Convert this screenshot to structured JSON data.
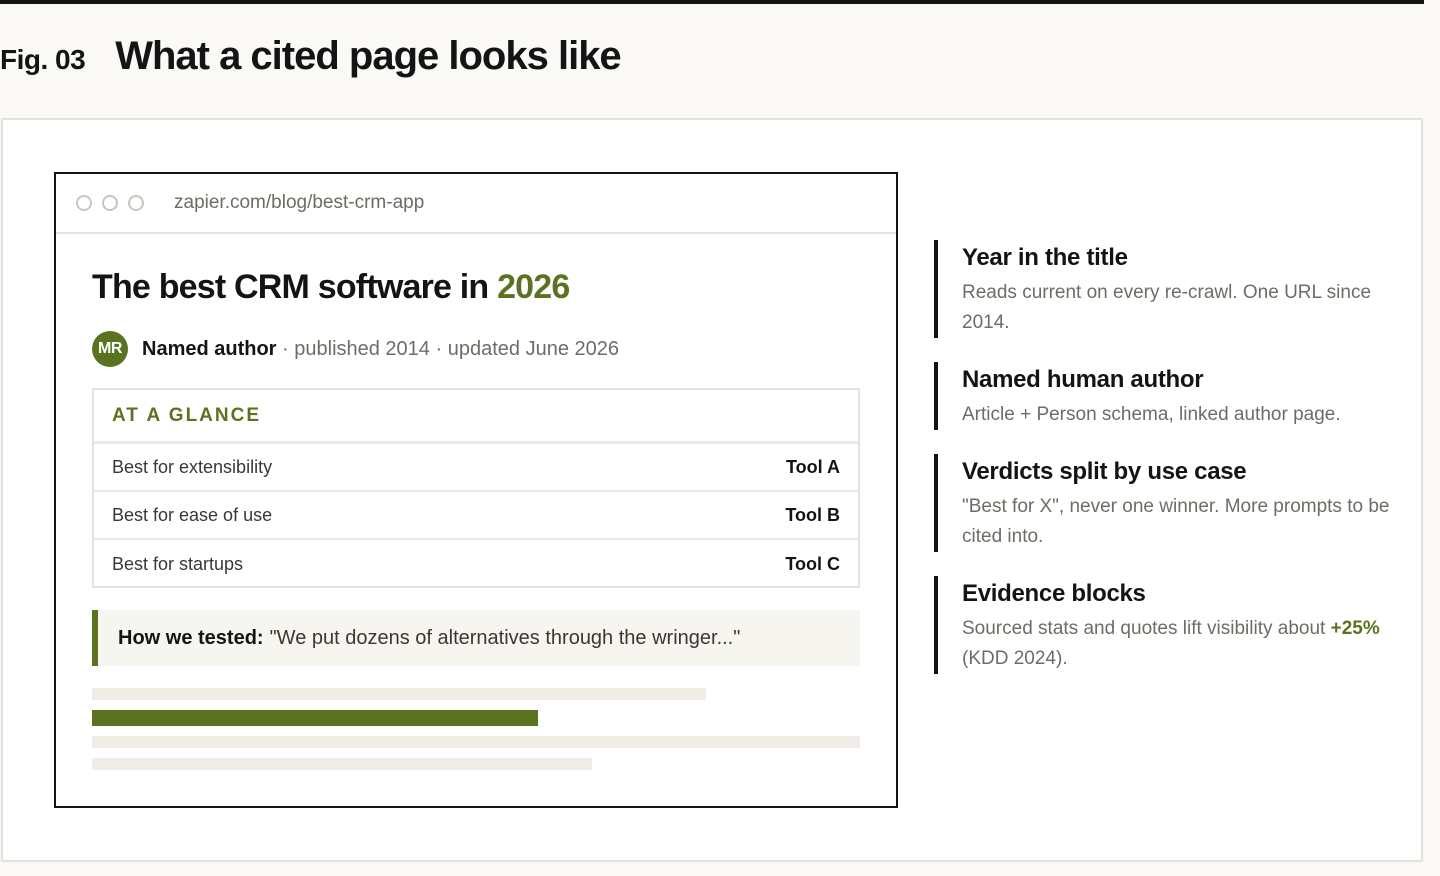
{
  "figure": {
    "label": "Fig. 03",
    "title": "What a cited page looks like"
  },
  "browser": {
    "url": "zapier.com/blog/best-crm-app",
    "title_main": "The best CRM software in ",
    "title_year": "2026",
    "avatar_initials": "MR",
    "author": "Named author",
    "byline_sep": " · ",
    "published": "published 2014",
    "updated": "updated June 2026",
    "glance_heading": "AT A GLANCE",
    "glance_rows": [
      {
        "label": "Best for extensibility",
        "tool": "Tool A"
      },
      {
        "label": "Best for ease of use",
        "tool": "Tool B"
      },
      {
        "label": "Best for startups",
        "tool": "Tool C"
      }
    ],
    "quote_lead": "How we tested:",
    "quote_text": "\"We put dozens of alternatives through the wringer...\""
  },
  "notes": [
    {
      "title": "Year in the title",
      "body": "Reads current on every re-crawl. One URL since 2014."
    },
    {
      "title": "Named human author",
      "body": "Article + Person schema, linked author page."
    },
    {
      "title": "Verdicts split by use case",
      "body": "\"Best for X\", never one winner. More prompts to be cited into."
    },
    {
      "title": "Evidence blocks",
      "body_pre": "Sourced stats and quotes lift visibility about ",
      "body_accent": "+25%",
      "body_post": " (KDD 2024)."
    }
  ],
  "colors": {
    "accent": "#5b7320",
    "ink": "#141414",
    "muted": "#6f6c64",
    "page_bg": "#faf9f5"
  }
}
